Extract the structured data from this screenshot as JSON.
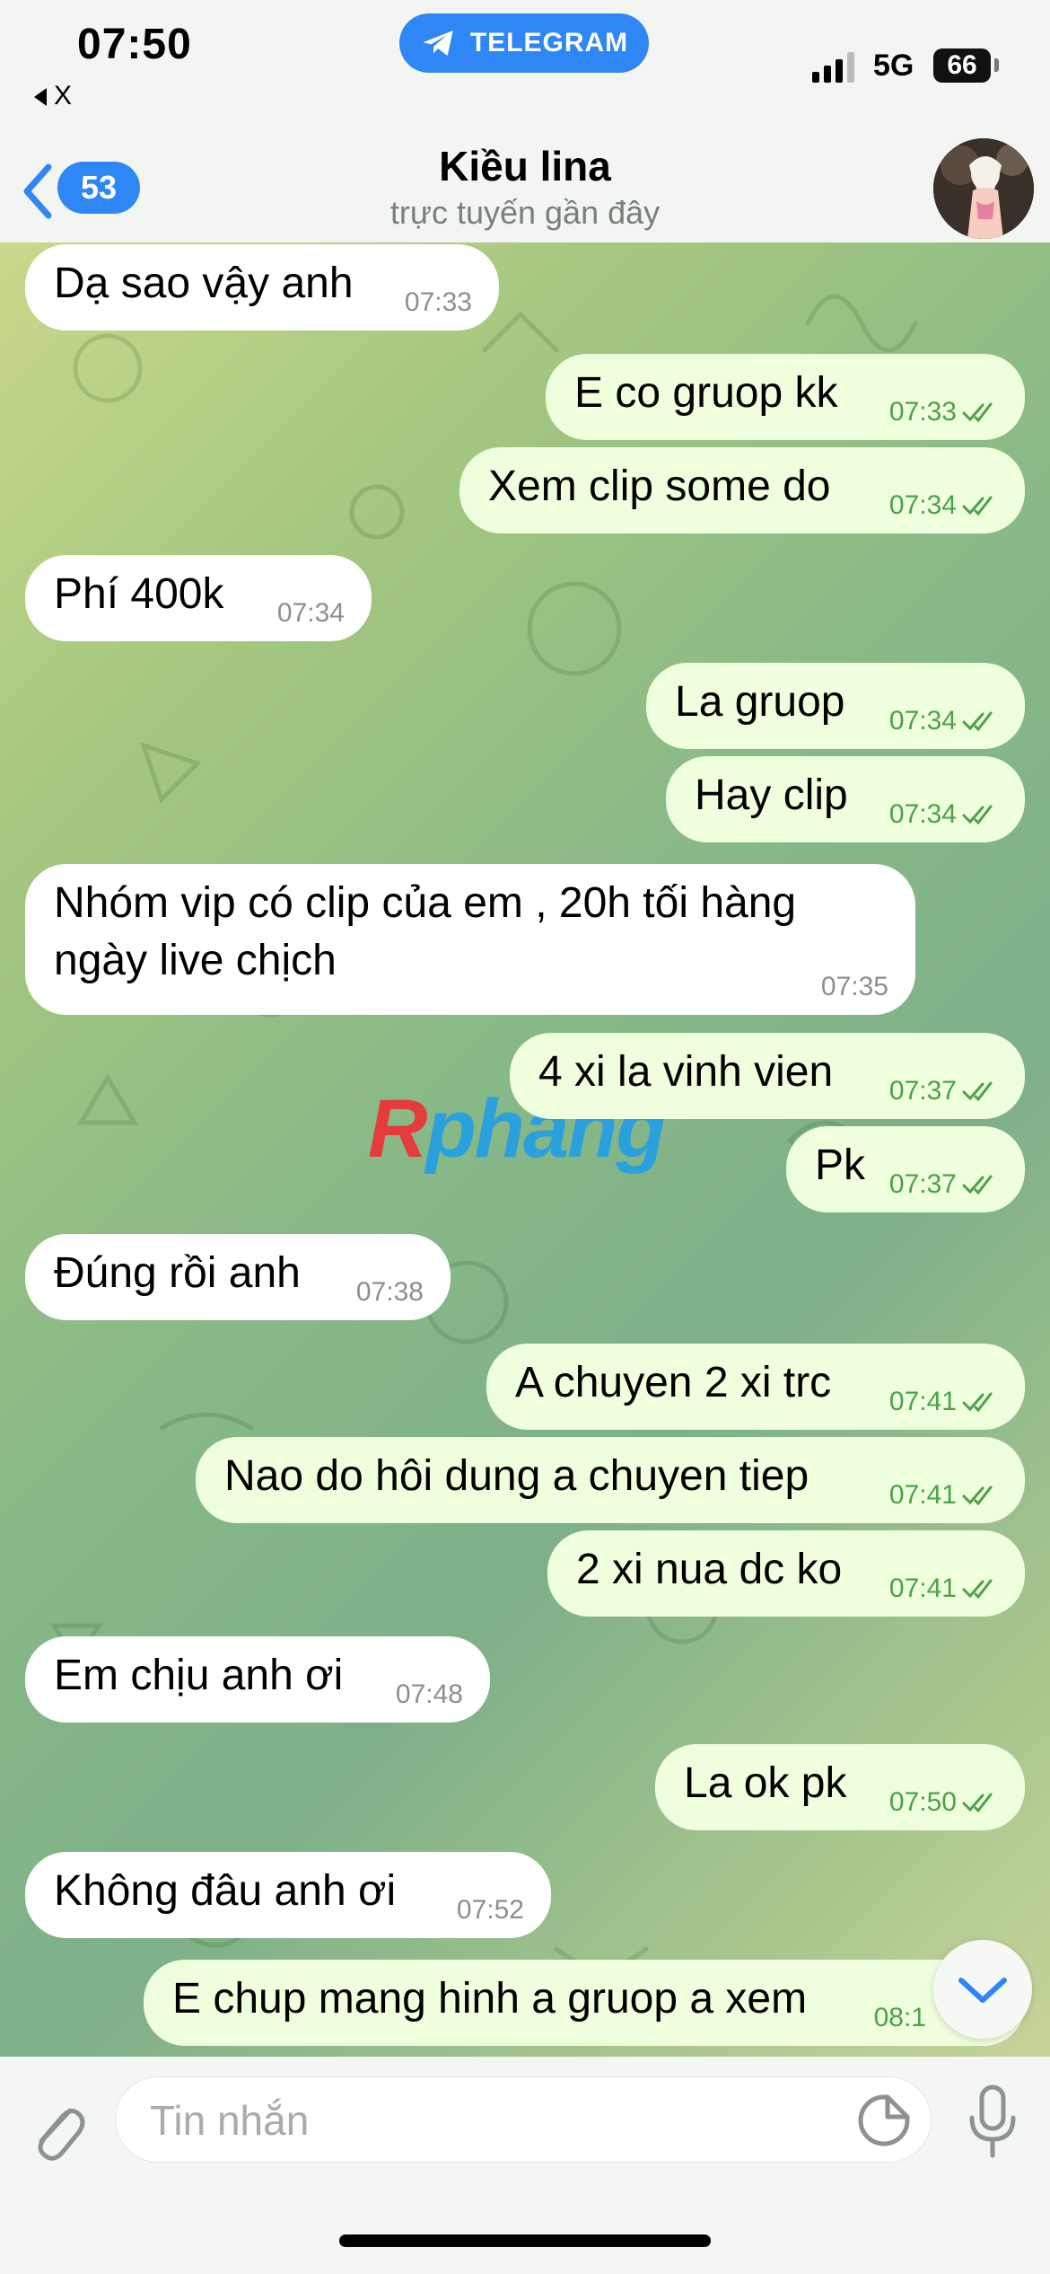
{
  "status_bar": {
    "time": "07:50",
    "back_app": "X",
    "telegram_label": "TELEGRAM",
    "network": "5G",
    "battery": "66"
  },
  "header": {
    "back_count": "53",
    "title": "Kiều lina",
    "subtitle": "trực tuyến gần đây"
  },
  "watermark": {
    "first": "R",
    "rest": "phang"
  },
  "messages": [
    {
      "dir": "in",
      "text": "Dạ sao vậy anh",
      "time": "07:33"
    },
    {
      "dir": "out",
      "text": "E co gruop kk",
      "time": "07:33"
    },
    {
      "dir": "out",
      "text": "Xem clip some do",
      "time": "07:34"
    },
    {
      "dir": "in",
      "text": "Phí 400k",
      "time": "07:34"
    },
    {
      "dir": "out",
      "text": "La gruop",
      "time": "07:34"
    },
    {
      "dir": "out",
      "text": "Hay clip",
      "time": "07:34"
    },
    {
      "dir": "in",
      "text": "Nhóm vip có clip của em , 20h tối hàng",
      "text2": "ngày live chịch",
      "time": "07:35"
    },
    {
      "dir": "out",
      "text": "4 xi la vinh vien",
      "time": "07:37"
    },
    {
      "dir": "out",
      "text": "Pk",
      "time": "07:37"
    },
    {
      "dir": "in",
      "text": "Đúng rồi anh",
      "time": "07:38"
    },
    {
      "dir": "out",
      "text": "A chuyen 2 xi trc",
      "time": "07:41"
    },
    {
      "dir": "out",
      "text": "Nao do hôi dung a chuyen tiep",
      "time": "07:41"
    },
    {
      "dir": "out",
      "text": "2 xi nua dc ko",
      "time": "07:41"
    },
    {
      "dir": "in",
      "text": "Em chịu anh ơi",
      "time": "07:48"
    },
    {
      "dir": "out",
      "text": "La ok pk",
      "time": "07:50"
    },
    {
      "dir": "in",
      "text": "Không đâu anh ơi",
      "time": "07:52"
    },
    {
      "dir": "out",
      "text": "E chup mang hinh a gruop a xem",
      "time": "08:1"
    }
  ],
  "input": {
    "placeholder": "Tin nhắn",
    "value": ""
  },
  "icons": {
    "telegram": "telegram-plane-icon",
    "attach": "paperclip-icon",
    "sticker": "sticker-icon",
    "mic": "microphone-icon",
    "scroll": "chevron-down-icon"
  },
  "colors": {
    "accent": "#2f86f5",
    "outgoing_bubble": "#effedd",
    "incoming_bubble": "#ffffff",
    "outgoing_time": "#4ba24a",
    "watermark_r": "#e53b3b",
    "watermark_rest": "#2aa0dc"
  }
}
